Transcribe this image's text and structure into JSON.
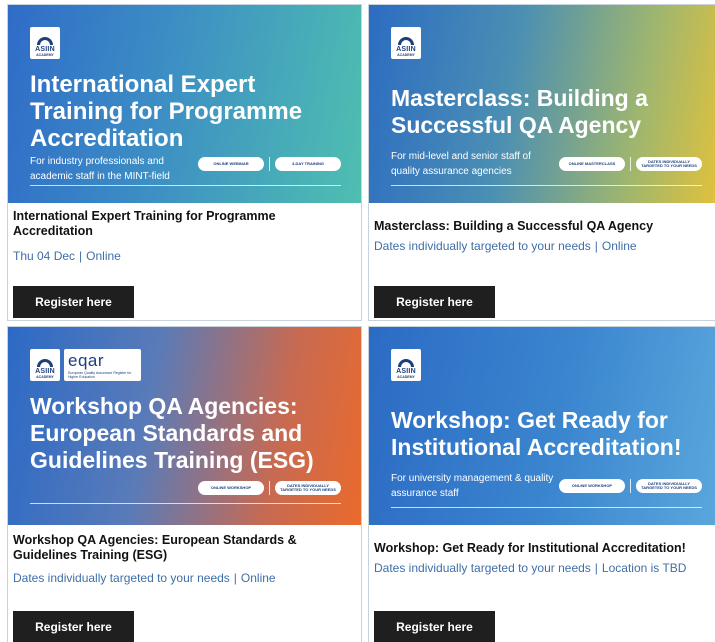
{
  "cards": [
    {
      "logo": {
        "name": "ASIIN",
        "sub": "ACADEMY"
      },
      "banner_title": "International Expert Training for Programme Accreditation",
      "banner_subtitle": "For industry professionals and academic staff in the MINT-field",
      "pills": [
        "ONLINE WEBINAR",
        "3-DAY TRAINING"
      ],
      "title": "International Expert Training for Programme Accreditation",
      "date": "Thu 04 Dec",
      "location": "Online",
      "register_label": "Register here"
    },
    {
      "logo": {
        "name": "ASIIN",
        "sub": "ACADEMY"
      },
      "banner_title": "Masterclass: Building a Successful QA Agency",
      "banner_subtitle": "For mid-level and senior staff of quality assurance agencies",
      "pills": [
        "ONLINE MASTERCLASS",
        "DATES INDIVIDUALLY TARGETED TO YOUR NEEDS"
      ],
      "title": "Masterclass: Building a Successful QA Agency",
      "date": "Dates individually targeted to your needs",
      "location": "Online",
      "register_label": "Register here"
    },
    {
      "logo": {
        "name": "ASIIN",
        "sub": "ACADEMY"
      },
      "partner_logo": {
        "name": "eqar",
        "sub": "European Quality Assurance Register for Higher Education"
      },
      "banner_title": "Workshop QA Agencies: European Standards and Guidelines Training (ESG)",
      "pills": [
        "ONLINE WORKSHOP",
        "DATES INDIVIDUALLY TARGETED TO YOUR NEEDS"
      ],
      "title": "Workshop QA Agencies: European Standards & Guidelines Training (ESG)",
      "date": "Dates individually targeted to your needs",
      "location": "Online",
      "register_label": "Register here"
    },
    {
      "logo": {
        "name": "ASIIN",
        "sub": "ACADEMY"
      },
      "banner_title": "Workshop: Get Ready for Institutional Accreditation!",
      "banner_subtitle": "For university management & quality assurance staff",
      "pills": [
        "ONLINE WORKSHOP",
        "DATES INDIVIDUALLY TARGETED TO YOUR NEEDS"
      ],
      "title": "Workshop: Get Ready for Institutional Accreditation!",
      "date": "Dates individually targeted to your needs",
      "location": "Location is TBD",
      "register_label": "Register here"
    }
  ],
  "separator": "|",
  "colors": {
    "meta_text": "#3f6fa8",
    "button_bg": "#1f1f1f",
    "logo_navy": "#1d3f7a"
  }
}
